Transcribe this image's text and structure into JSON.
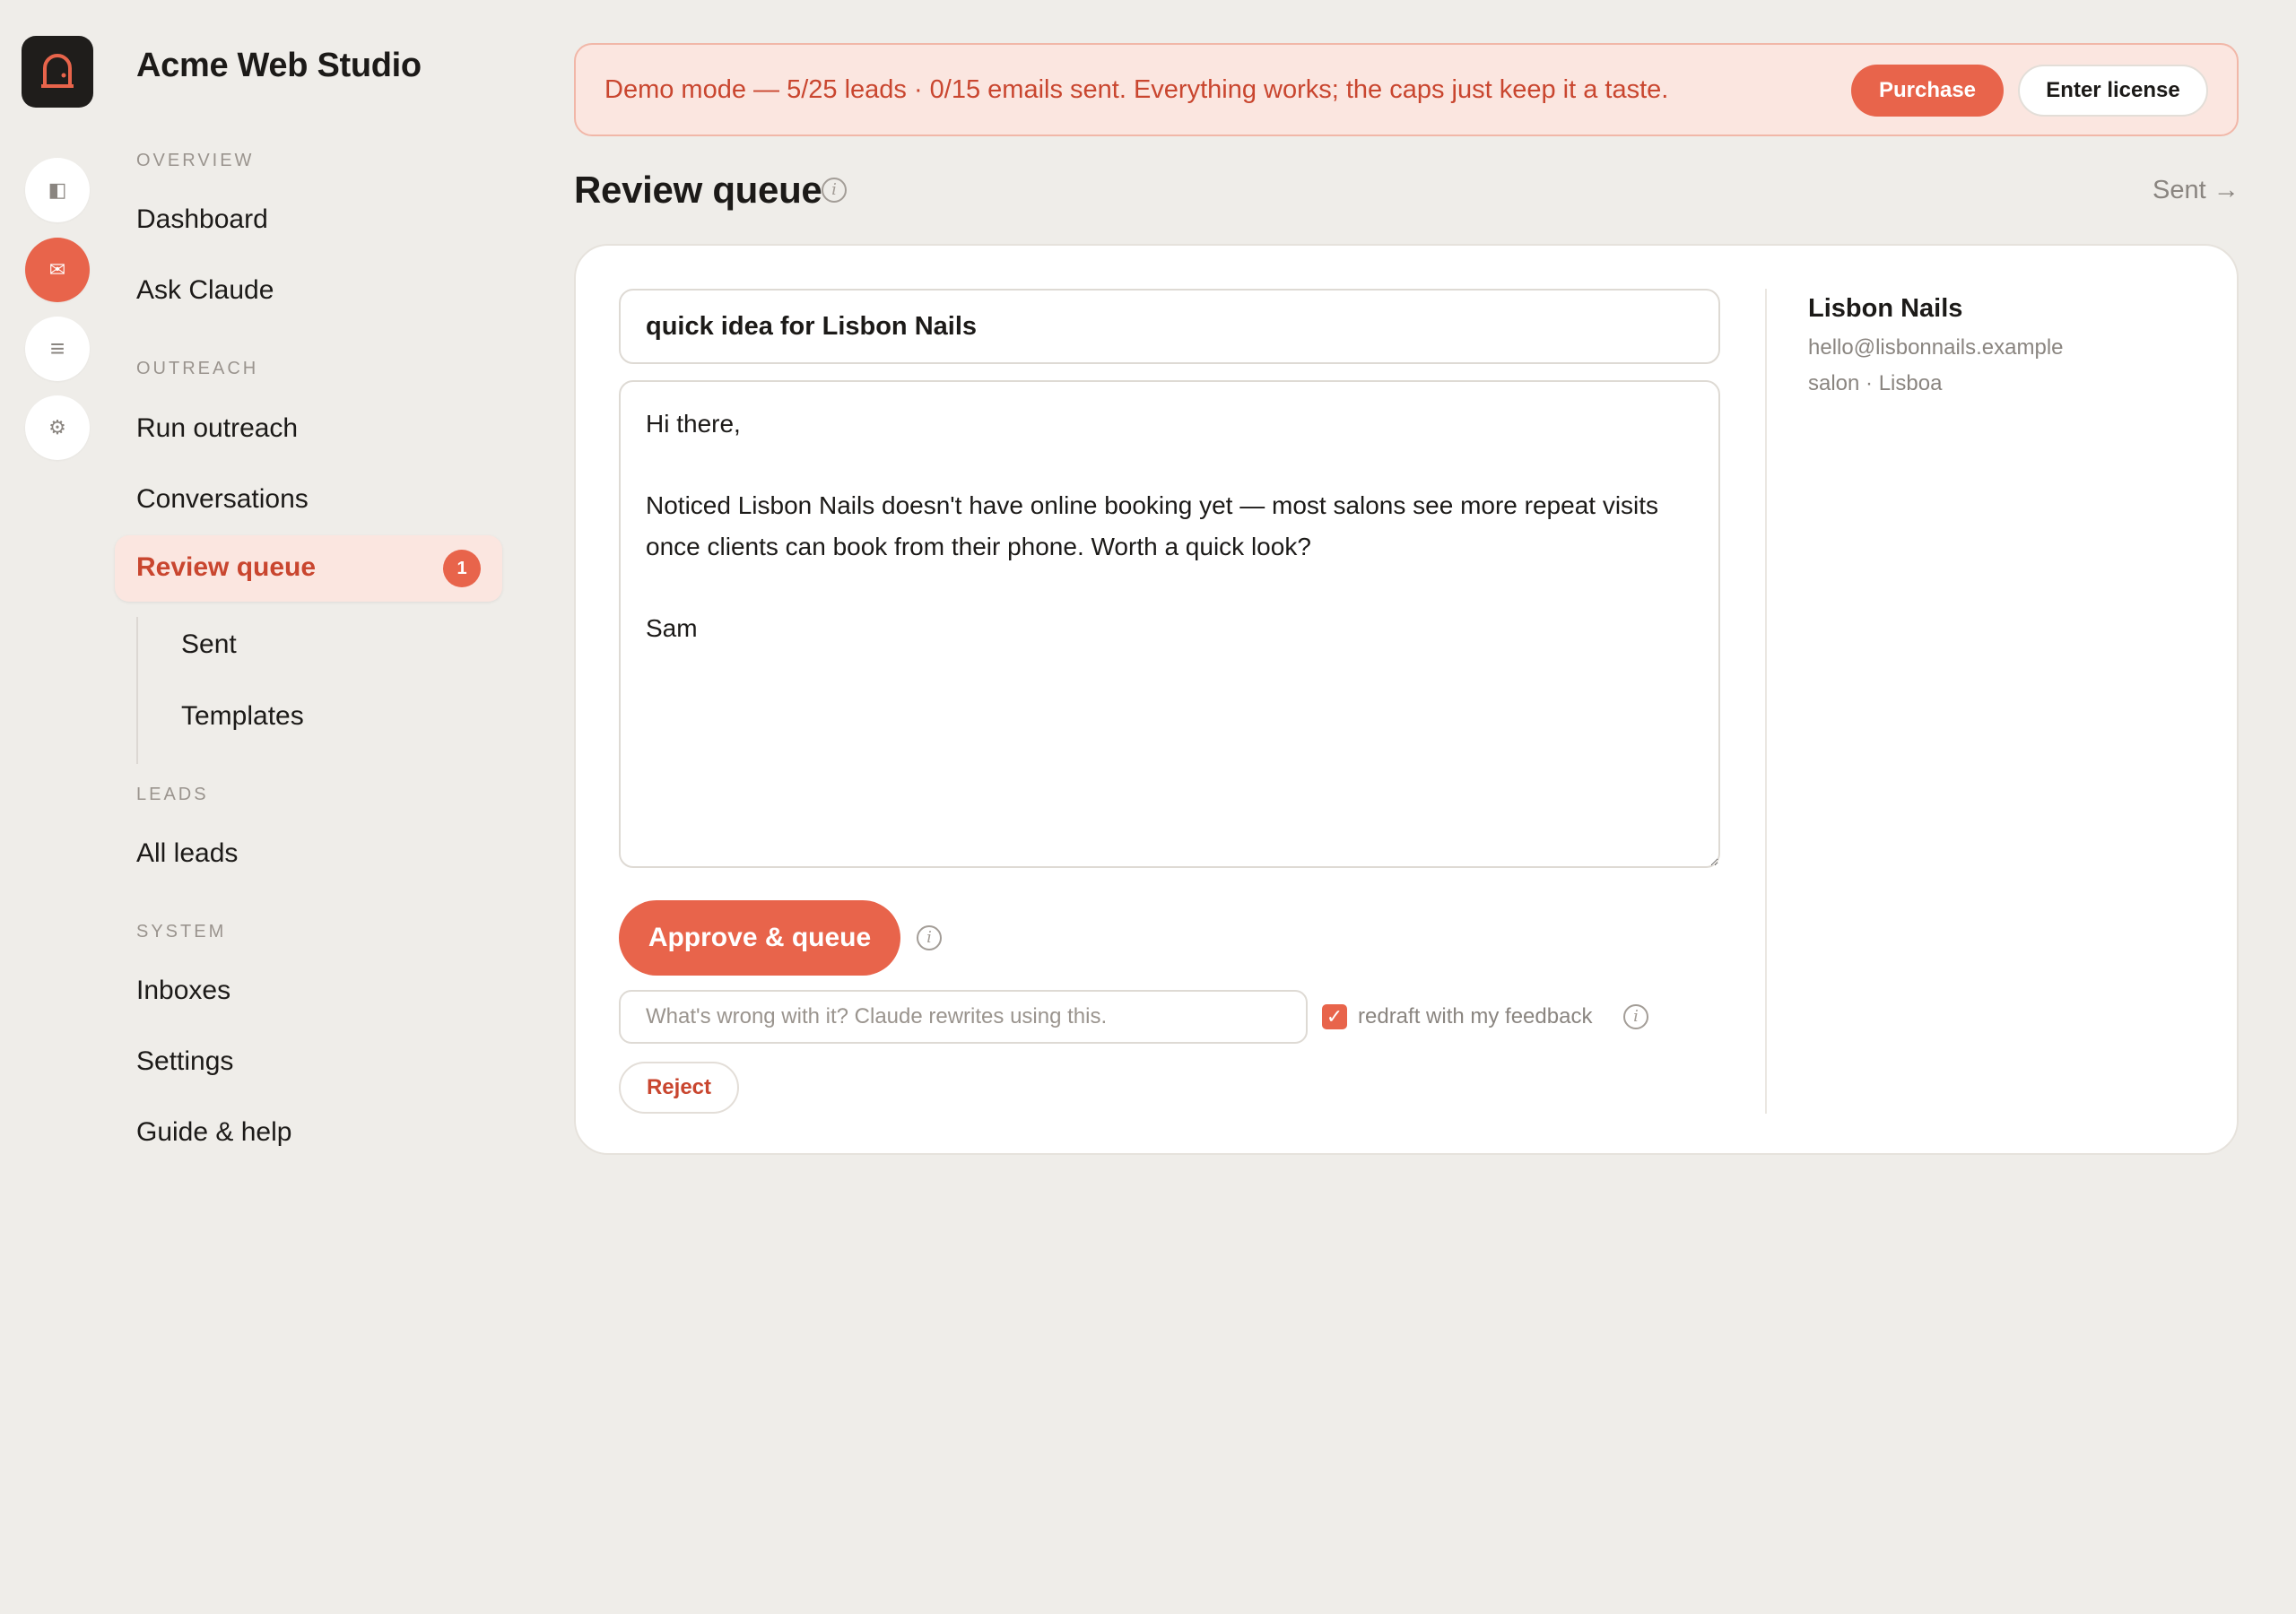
{
  "app": {
    "name": "Acme Web Studio"
  },
  "rail": {
    "items": [
      {
        "icon": "panel-icon",
        "glyph": "◧"
      },
      {
        "icon": "mail-icon",
        "glyph": "✉"
      },
      {
        "icon": "list-icon",
        "glyph": "≡"
      },
      {
        "icon": "gear-icon",
        "glyph": "⚙"
      }
    ]
  },
  "sidebar": {
    "sections": {
      "overview": "OVERVIEW",
      "outreach": "OUTREACH",
      "leads": "LEADS",
      "system": "SYSTEM"
    },
    "items": {
      "dashboard": "Dashboard",
      "ask_claude": "Ask Claude",
      "run_outreach": "Run outreach",
      "conversations": "Conversations",
      "review_queue": "Review queue",
      "review_queue_badge": "1",
      "sent": "Sent",
      "templates": "Templates",
      "all_leads": "All leads",
      "inboxes": "Inboxes",
      "settings": "Settings",
      "guide": "Guide & help"
    }
  },
  "banner": {
    "text": "Demo mode — 5/25 leads · 0/15 emails sent. Everything works; the caps just keep it a taste.",
    "purchase_label": "Purchase",
    "license_label": "Enter license"
  },
  "header": {
    "title": "Review queue",
    "sent_link": "Sent →"
  },
  "draft": {
    "subject": "quick idea for Lisbon Nails",
    "body": "Hi there,\n\nNoticed Lisbon Nails doesn't have online booking yet — most salons see more repeat visits once clients can book from their phone. Worth a quick look?\n\nSam",
    "approve_label": "Approve & queue",
    "feedback_placeholder": "What's wrong with it? Claude rewrites using this.",
    "redraft_checked": true,
    "redraft_label": "redraft with my feedback",
    "reject_label": "Reject"
  },
  "lead": {
    "name": "Lisbon Nails",
    "email": "hello@lisbonnails.example",
    "meta": "salon · Lisboa"
  },
  "colors": {
    "accent": "#e8644b",
    "accent_text": "#c9462f",
    "background": "#efede9",
    "banner_bg": "#fbe6e0"
  }
}
